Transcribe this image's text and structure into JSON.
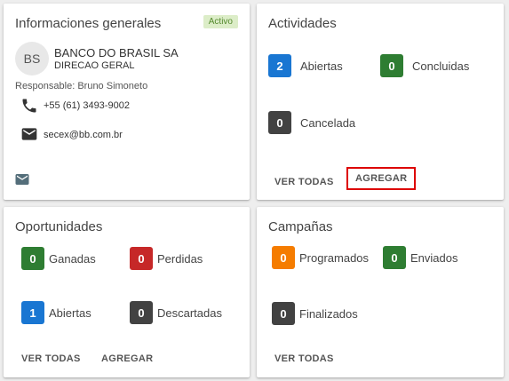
{
  "general": {
    "title": "Informaciones generales",
    "badge": "Activo",
    "avatar": "BS",
    "company": "BANCO DO BRASIL SA",
    "division": "DIRECAO GERAL",
    "responsible": "Responsable: Bruno Simoneto",
    "phone": "+55 (61) 3493-9002",
    "email": "secex@bb.com.br"
  },
  "activities": {
    "title": "Actividades",
    "stats": [
      {
        "count": "2",
        "label": "Abiertas",
        "color": "#1976d2"
      },
      {
        "count": "0",
        "label": "Concluidas",
        "color": "#2e7d32"
      },
      {
        "count": "0",
        "label": "Cancelada",
        "color": "#424242"
      }
    ],
    "view_all": "VER TODAS",
    "add": "AGREGAR"
  },
  "opportunities": {
    "title": "Oportunidades",
    "stats": [
      {
        "count": "0",
        "label": "Ganadas",
        "color": "#2e7d32"
      },
      {
        "count": "0",
        "label": "Perdidas",
        "color": "#c62828"
      },
      {
        "count": "1",
        "label": "Abiertas",
        "color": "#1976d2"
      },
      {
        "count": "0",
        "label": "Descartadas",
        "color": "#424242"
      }
    ],
    "view_all": "VER TODAS",
    "add": "AGREGAR"
  },
  "campaigns": {
    "title": "Campañas",
    "stats": [
      {
        "count": "0",
        "label": "Programados",
        "color": "#f57c00"
      },
      {
        "count": "0",
        "label": "Enviados",
        "color": "#2e7d32"
      },
      {
        "count": "0",
        "label": "Finalizados",
        "color": "#424242"
      }
    ],
    "view_all": "VER TODAS"
  },
  "icons": {
    "phone": "phone-icon",
    "email": "email-icon",
    "mail_action": "mail-icon"
  }
}
